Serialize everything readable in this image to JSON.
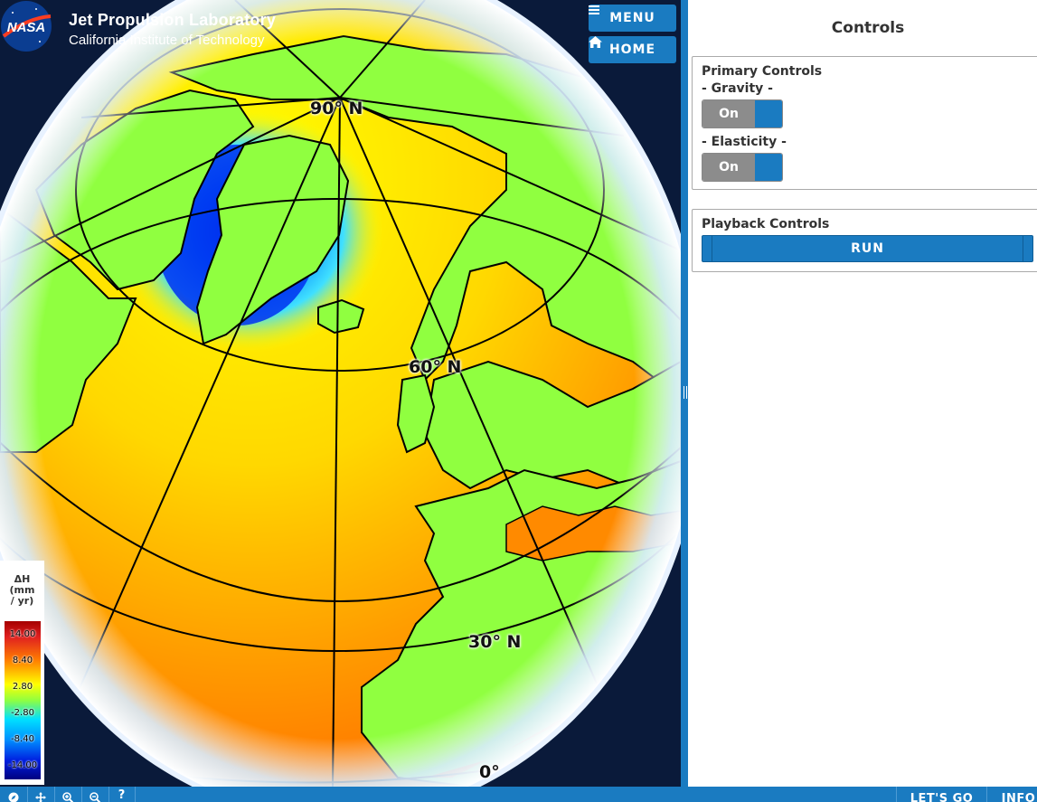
{
  "header": {
    "logo_text": "NASA",
    "title": "Jet Propulsion Laboratory",
    "subtitle": "California Institute of Technology"
  },
  "nav": {
    "menu_label": "MENU",
    "home_label": "HOME",
    "menu_icon": "hamburger-icon",
    "home_icon": "home-icon"
  },
  "map": {
    "latitude_labels": [
      "90° N",
      "60° N",
      "30° N",
      "0°"
    ]
  },
  "legend": {
    "title_line1": "ΔH",
    "title_line2": "(mm",
    "title_line3": "/ yr)",
    "ticks": [
      "14.00",
      "8.40",
      "2.80",
      "-2.80",
      "-8.40",
      "-14.00"
    ]
  },
  "controls": {
    "title": "Controls",
    "primary": {
      "title": "Primary Controls",
      "gravity_label": "- Gravity -",
      "gravity_value": "On",
      "elasticity_label": "- Elasticity -",
      "elasticity_value": "On"
    },
    "playback": {
      "title": "Playback Controls",
      "run_label": "RUN"
    }
  },
  "toolbar": {
    "tools": [
      "compass-icon",
      "pan-icon",
      "zoom-in-icon",
      "zoom-out-icon",
      "help-icon"
    ],
    "help_label": "?",
    "lets_go_label": "LET'S GO",
    "info_label": "INFO"
  },
  "colors": {
    "accent": "#1a7bc1",
    "ocean_warm": "#ff8000",
    "land": "#90ff40",
    "greenland_low": "#0010d0"
  }
}
